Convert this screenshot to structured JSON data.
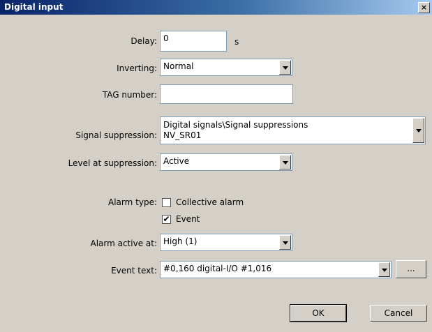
{
  "window": {
    "title": "Digital input",
    "close_label": "×"
  },
  "fields": {
    "delay": {
      "label": "Delay:",
      "value": "0",
      "unit": "s"
    },
    "inverting": {
      "label": "Inverting:",
      "value": "Normal"
    },
    "tag_number": {
      "label": "TAG number:",
      "value": ""
    },
    "signal_suppression": {
      "label": "Signal suppression:",
      "line1": "Digital signals\\Signal suppressions",
      "line2": "NV_SR01"
    },
    "level_at_suppression": {
      "label": "Level at suppression:",
      "value": "Active"
    },
    "alarm_type": {
      "label": "Alarm type:",
      "collective": {
        "label": "Collective alarm",
        "checked": false
      },
      "event": {
        "label": "Event",
        "checked": true,
        "mark": "✔"
      }
    },
    "alarm_active_at": {
      "label": "Alarm active at:",
      "value": "High (1)"
    },
    "event_text": {
      "label": "Event text:",
      "value": "#0,160 digital-I/O #1,016",
      "browse_label": "..."
    }
  },
  "buttons": {
    "ok": "OK",
    "cancel": "Cancel"
  }
}
